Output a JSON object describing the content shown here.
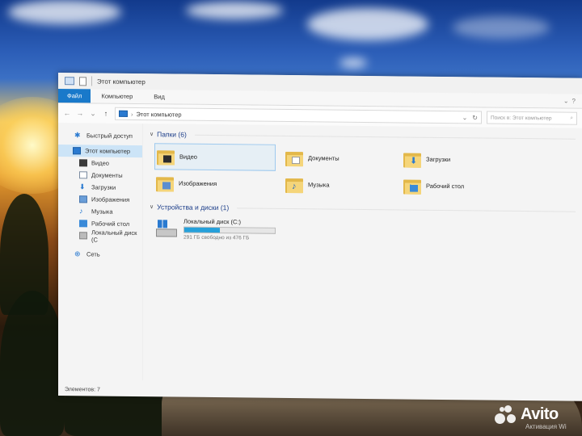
{
  "window": {
    "title": "Этот компьютер"
  },
  "ribbon": {
    "tabs": [
      "Файл",
      "Компьютер",
      "Вид"
    ]
  },
  "address": {
    "path": "Этот компьютер",
    "search_placeholder": "Поиск в: Этот компьютер"
  },
  "navpane": {
    "quick_access": "Быстрый доступ",
    "this_pc": "Этот компьютер",
    "items": [
      "Видео",
      "Документы",
      "Загрузки",
      "Изображения",
      "Музыка",
      "Рабочий стол",
      "Локальный диск (С"
    ],
    "network": "Сеть"
  },
  "groups": {
    "folders_title": "Папки (6)",
    "folders": [
      "Видео",
      "Документы",
      "Загрузки",
      "Изображения",
      "Музыка",
      "Рабочий стол"
    ],
    "devices_title": "Устройства и диски (1)"
  },
  "drive": {
    "name": "Локальный диск (C:)",
    "free_text": "291 ГБ свободно из 476 ГБ",
    "used_fraction": 0.39
  },
  "status": {
    "items_count": "Элементов: 7"
  },
  "watermark": {
    "brand": "Avito",
    "activation": "Активация Wi"
  },
  "icons": {
    "search": "search-icon",
    "refresh": "refresh-icon",
    "help": "help-icon"
  },
  "colors": {
    "accent": "#1979ca",
    "selection": "#cce4f7",
    "folder": "#e3b84a",
    "drive_bar": "#26a0da"
  }
}
